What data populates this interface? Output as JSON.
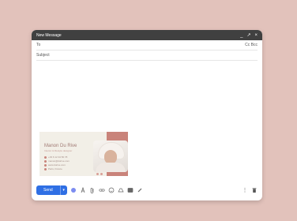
{
  "compose": {
    "title": "New Message",
    "controls": [
      "_",
      "↗",
      "×"
    ],
    "to_label": "To",
    "cc_bcc": "Cc Bcc",
    "subject_label": "Subject",
    "send_label": "Send",
    "send_dropdown": "▾",
    "more_options": "⋮"
  },
  "signature": {
    "name": "Manon Du Rive",
    "role": "Interior & lifestyle designer",
    "lines": [
      "+33 6 12 34 56 78",
      "manon@durive.com",
      "www.durive.com",
      "Paris, France"
    ]
  },
  "colors": {
    "background": "#e2c2bb",
    "titlebar": "#404040",
    "send": "#2f6fe4",
    "card": "#f2efe7",
    "accent": "#c9837a"
  },
  "icons": [
    "format-color-icon",
    "text-format-icon",
    "attach-icon",
    "link-icon",
    "emoji-icon",
    "drive-icon",
    "photo-icon",
    "signature-pen-icon",
    "more-icon",
    "trash-icon"
  ]
}
